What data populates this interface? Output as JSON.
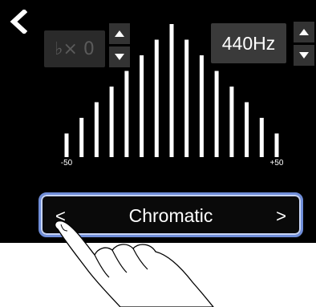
{
  "tuner": {
    "flat_value": "♭× 0",
    "calibration": "440Hz"
  },
  "meter": {
    "min_label": "-50",
    "max_label": "+50",
    "bar_count": 15
  },
  "mode_selector": {
    "prev_label": "<",
    "mode": "Chromatic",
    "next_label": ">"
  },
  "icons": {
    "back": "chevron-left-icon",
    "up": "triangle-up-icon",
    "down": "triangle-down-icon",
    "hand": "pointing-hand-icon"
  },
  "colors": {
    "screen_bg": "#000000",
    "selection_border": "#6f8dd8"
  }
}
